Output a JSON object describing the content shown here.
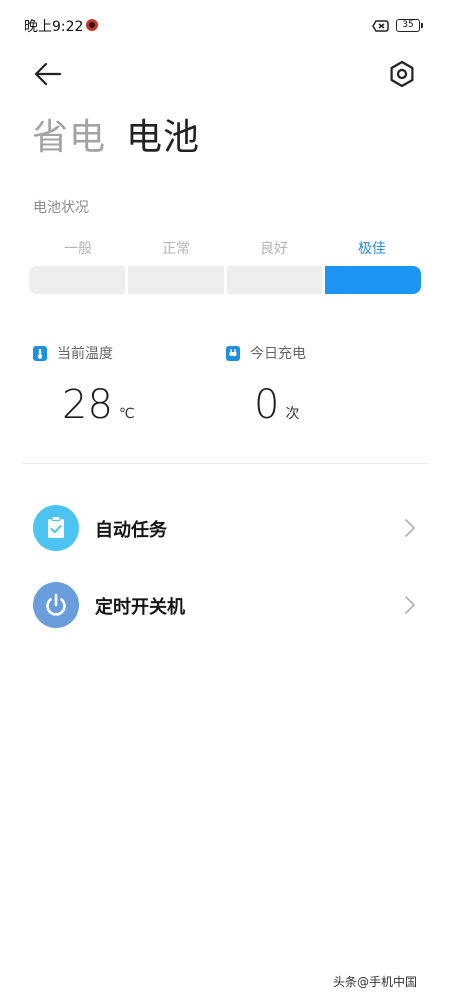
{
  "status_bar": {
    "time": "晚上9:22",
    "battery_level": "35",
    "icons": [
      "notification-dot-icon",
      "no-sim-icon",
      "battery-icon"
    ]
  },
  "header": {
    "back_icon": "arrow-left-icon",
    "settings_icon": "hexagon-settings-icon",
    "tab_inactive": "省电",
    "tab_active": "电池"
  },
  "battery_health": {
    "label": "电池状况",
    "levels": [
      "一般",
      "正常",
      "良好",
      "极佳"
    ],
    "current_level_index": 3,
    "accent_color": "#1c96f2"
  },
  "stats": {
    "temperature": {
      "title": "当前温度",
      "value": "28",
      "unit": "℃",
      "icon": "thermometer-icon"
    },
    "charges": {
      "title": "今日充电",
      "value": "0",
      "unit": "次",
      "icon": "plug-icon"
    }
  },
  "list": [
    {
      "label": "自动任务",
      "icon": "clipboard-check-icon",
      "color": "#4cc3f1"
    },
    {
      "label": "定时开关机",
      "icon": "power-icon",
      "color": "#6a9ddb"
    }
  ],
  "watermark": "头条@手机中国"
}
